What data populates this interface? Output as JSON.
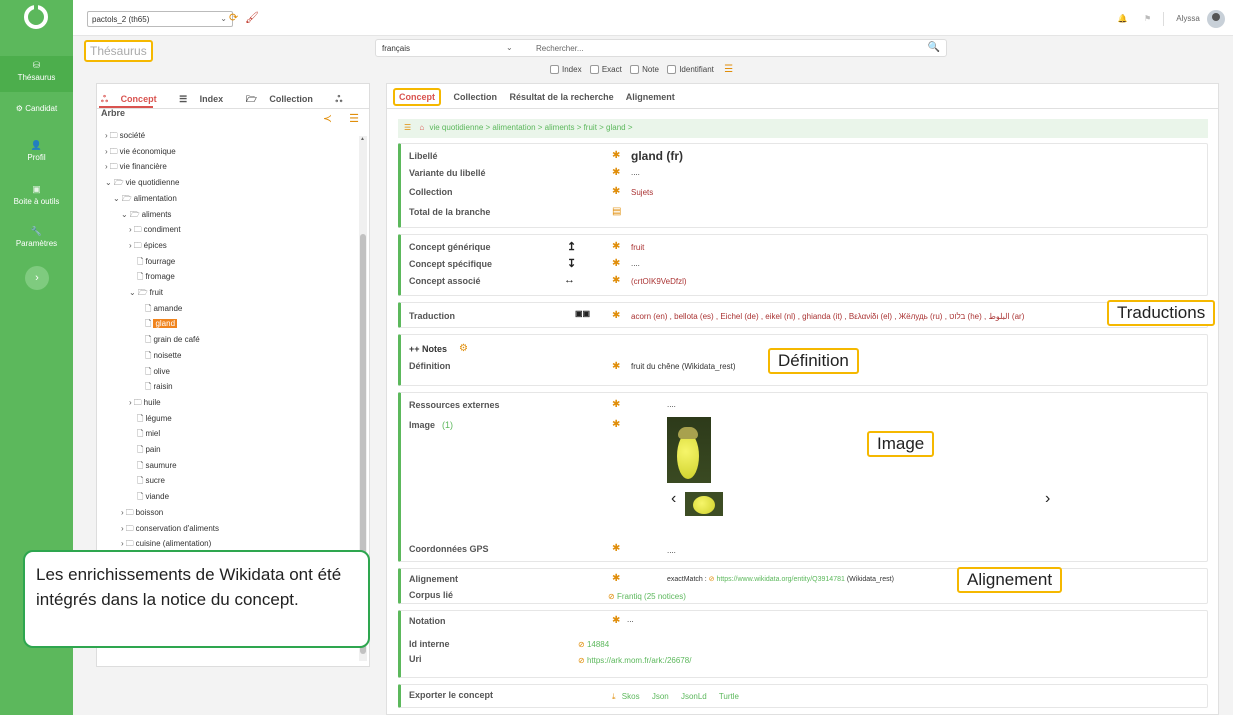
{
  "sidebar": {
    "items": [
      {
        "label": "Thésaurus",
        "icon": "database-icon",
        "active": true
      },
      {
        "label": "Candidat",
        "icon": "gear-icon"
      },
      {
        "label": "Profil",
        "icon": "user-icon"
      },
      {
        "label": "Boite à outils",
        "icon": "toolbox-icon"
      },
      {
        "label": "Paramètres",
        "icon": "wrench-icon"
      }
    ]
  },
  "topbar": {
    "thesaurus_select": "pactols_2 (th65)",
    "user": "Alyssa"
  },
  "page_title": "Thésaurus",
  "search": {
    "language": "français",
    "placeholder": "Rechercher...",
    "filters": [
      "Index",
      "Exact",
      "Note",
      "Identifiant"
    ]
  },
  "left_tabs": [
    "Concept",
    "Index",
    "Collection",
    "Arbre"
  ],
  "tree": [
    {
      "label": "société",
      "level": 0,
      "type": "folder",
      "state": "closed"
    },
    {
      "label": "vie économique",
      "level": 0,
      "type": "folder",
      "state": "closed"
    },
    {
      "label": "vie financière",
      "level": 0,
      "type": "folder",
      "state": "closed"
    },
    {
      "label": "vie quotidienne",
      "level": 0,
      "type": "folder",
      "state": "open"
    },
    {
      "label": "alimentation",
      "level": 1,
      "type": "folder",
      "state": "open"
    },
    {
      "label": "aliments",
      "level": 2,
      "type": "folder",
      "state": "open"
    },
    {
      "label": "condiment",
      "level": 3,
      "type": "folder",
      "state": "closed"
    },
    {
      "label": "épices",
      "level": 3,
      "type": "folder",
      "state": "closed"
    },
    {
      "label": "fourrage",
      "level": 3,
      "type": "file"
    },
    {
      "label": "fromage",
      "level": 3,
      "type": "file"
    },
    {
      "label": "fruit",
      "level": 3,
      "type": "folder",
      "state": "open"
    },
    {
      "label": "amande",
      "level": 4,
      "type": "file"
    },
    {
      "label": "gland",
      "level": 4,
      "type": "file",
      "selected": true
    },
    {
      "label": "grain de café",
      "level": 4,
      "type": "file"
    },
    {
      "label": "noisette",
      "level": 4,
      "type": "file"
    },
    {
      "label": "olive",
      "level": 4,
      "type": "file"
    },
    {
      "label": "raisin",
      "level": 4,
      "type": "file"
    },
    {
      "label": "huile",
      "level": 3,
      "type": "folder",
      "state": "closed"
    },
    {
      "label": "légume",
      "level": 3,
      "type": "file"
    },
    {
      "label": "miel",
      "level": 3,
      "type": "file"
    },
    {
      "label": "pain",
      "level": 3,
      "type": "file"
    },
    {
      "label": "saumure",
      "level": 3,
      "type": "file"
    },
    {
      "label": "sucre",
      "level": 3,
      "type": "file"
    },
    {
      "label": "viande",
      "level": 3,
      "type": "file"
    },
    {
      "label": "boisson",
      "level": 2,
      "type": "folder",
      "state": "closed"
    },
    {
      "label": "conservation d'aliments",
      "level": 2,
      "type": "folder",
      "state": "closed"
    },
    {
      "label": "cuisine (alimentation)",
      "level": 2,
      "type": "folder",
      "state": "closed"
    }
  ],
  "callout": "Les enrichissements de Wikidata ont été intégrés dans la notice du concept.",
  "right_tabs": [
    "Concept",
    "Collection",
    "Résultat de la recherche",
    "Alignement"
  ],
  "breadcrumb": "vie quotidienne > alimentation > aliments > fruit > gland >",
  "concept": {
    "libelle_label": "Libellé",
    "libelle": "gland (fr)",
    "variante_label": "Variante du libellé",
    "variante": "....",
    "collection_label": "Collection",
    "collection": "Sujets",
    "total_label": "Total de la branche",
    "generique_label": "Concept générique",
    "generique": "fruit",
    "specifique_label": "Concept spécifique",
    "specifique": "....",
    "associe_label": "Concept associé",
    "associe": "(crtOIK9VeDfzl)",
    "traduction_label": "Traduction",
    "traduction": "acorn (en) , bellota (es) , Eichel (de) , eikel (nl) , ghianda (it) , Βελανίδι (el) , Жёлудь (ru) , בלוט (he) , البلوط (ar)",
    "notes_label": "++ Notes",
    "definition_label": "Définition",
    "definition": "fruit du chêne (Wikidata_rest)",
    "ressources_label": "Ressources externes",
    "ressources": "....",
    "image_label": "Image",
    "image_count": "(1)",
    "gps_label": "Coordonnées GPS",
    "gps": "....",
    "alignement_label": "Alignement",
    "alignement_prefix": "exactMatch :",
    "alignement_url": "https://www.wikidata.org/entity/Q3914781",
    "alignement_suffix": "(Wikidata_rest)",
    "corpus_label": "Corpus lié",
    "corpus": "Frantiq (25 notices)",
    "notation_label": "Notation",
    "notation": "...",
    "id_label": "Id interne",
    "id": "14884",
    "uri_label": "Uri",
    "uri": "https://ark.mom.fr/ark:/26678/",
    "export_label": "Exporter le concept",
    "export_formats": [
      "Skos",
      "Json",
      "JsonLd",
      "Turtle"
    ]
  },
  "annotations": {
    "traductions": "Traductions",
    "definition": "Définition",
    "image": "Image",
    "alignement": "Alignement"
  },
  "colors": {
    "green": "#5cb85c",
    "highlight": "#f5b800",
    "accent": "#e08e0b",
    "selected": "#f0841e"
  }
}
